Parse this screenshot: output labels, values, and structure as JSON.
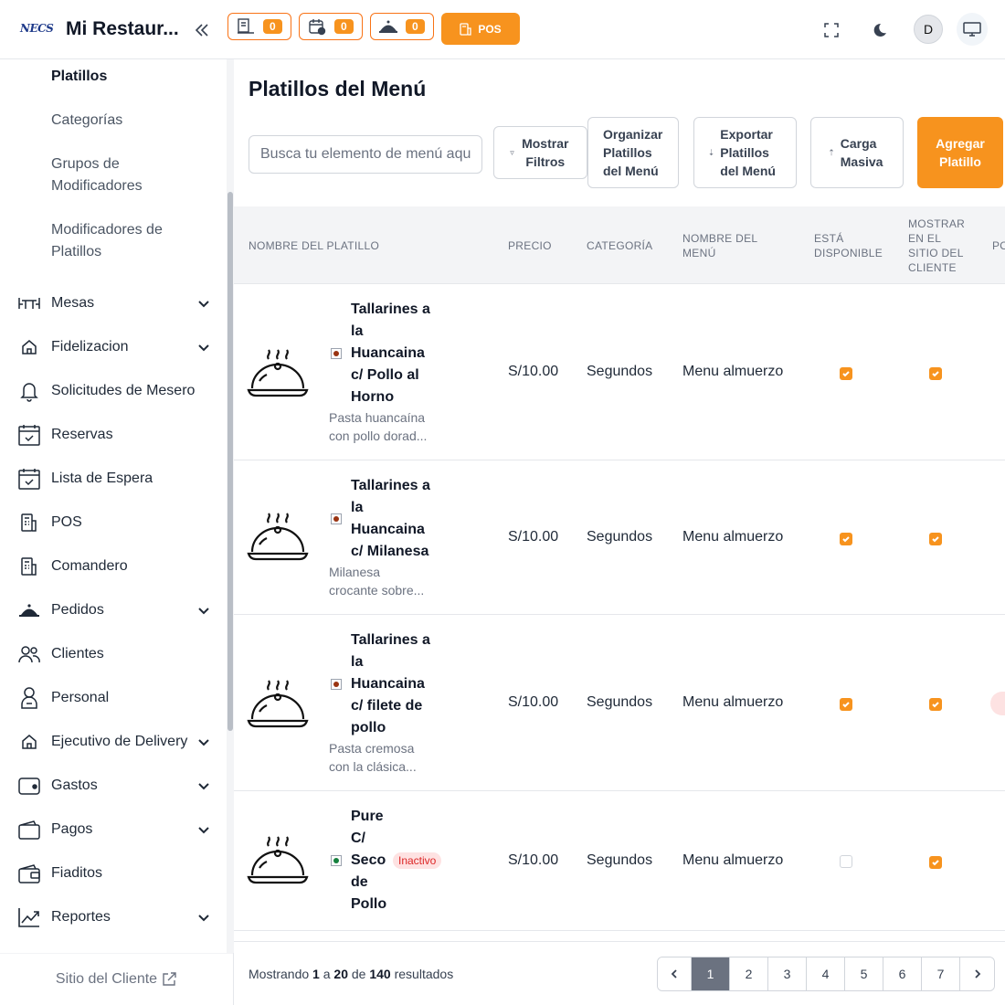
{
  "header": {
    "logo_text": "NECS",
    "restaurant_name": "Mi Restaur...",
    "counters": [
      {
        "name": "orders-counter",
        "value": "0"
      },
      {
        "name": "reservations-counter",
        "value": "0"
      },
      {
        "name": "waiter-counter",
        "value": "0"
      }
    ],
    "pos_label": "POS",
    "avatar_initial": "D"
  },
  "sidebar": {
    "sub_items": [
      "Platillos",
      "Categorías",
      "Grupos de Modificadores",
      "Modificadores de Platillos"
    ],
    "items": [
      {
        "label": "Mesas",
        "icon": "tables-icon",
        "expandable": true
      },
      {
        "label": "Fidelizacion",
        "icon": "home-icon",
        "expandable": true
      },
      {
        "label": "Solicitudes de Mesero",
        "icon": "bell-icon",
        "expandable": false
      },
      {
        "label": "Reservas",
        "icon": "calendar-icon",
        "expandable": false
      },
      {
        "label": "Lista de Espera",
        "icon": "calendar-check-icon",
        "expandable": false
      },
      {
        "label": "POS",
        "icon": "pos-icon",
        "expandable": false
      },
      {
        "label": "Comandero",
        "icon": "pos-icon",
        "expandable": false
      },
      {
        "label": "Pedidos",
        "icon": "cloche-icon",
        "expandable": true
      },
      {
        "label": "Clientes",
        "icon": "users-icon",
        "expandable": false
      },
      {
        "label": "Personal",
        "icon": "person-icon",
        "expandable": false
      },
      {
        "label": "Ejecutivo de Delivery",
        "icon": "home-icon",
        "expandable": true
      },
      {
        "label": "Gastos",
        "icon": "wallet-icon",
        "expandable": true
      },
      {
        "label": "Pagos",
        "icon": "wallet-icon",
        "expandable": true
      },
      {
        "label": "Fiaditos",
        "icon": "wallet-icon",
        "expandable": false
      },
      {
        "label": "Reportes",
        "icon": "chart-icon",
        "expandable": true
      }
    ],
    "footer_link": "Sitio del Cliente"
  },
  "main": {
    "title": "Platillos del Menú",
    "search_placeholder": "Busca tu elemento de menú aquí",
    "buttons": {
      "filters": "Mostrar Filtros",
      "organize": "Organizar Platillos del Menú",
      "export": "Exportar Platillos del Menú",
      "upload": "Carga Masiva",
      "add": "Agregar Platillo"
    }
  },
  "table": {
    "columns": {
      "name": "NOMBRE DEL PLATILLO",
      "price": "PRECIO",
      "category": "CATEGORÍA",
      "menu": "NOMBRE DEL MENÚ",
      "available": "ESTÁ DISPONIBLE",
      "show_site": "MOSTRAR EN EL SITIO DEL CLIENTE",
      "more": "PO"
    },
    "rows": [
      {
        "name_lines": [
          "Tallarines a",
          "la",
          "Huancaina",
          "c/ Pollo al",
          "Horno"
        ],
        "desc_lines": [
          "Pasta huancaína",
          "con pollo dorad..."
        ],
        "price": "S/10.00",
        "category": "Segundos",
        "menu": "Menu almuerzo",
        "available": true,
        "show_site": true,
        "veg_color": "#9a3412",
        "inactive": ""
      },
      {
        "name_lines": [
          "Tallarines a",
          "la",
          "Huancaina",
          "c/ Milanesa"
        ],
        "desc_lines": [
          "Milanesa",
          "crocante sobre..."
        ],
        "price": "S/10.00",
        "category": "Segundos",
        "menu": "Menu almuerzo",
        "available": true,
        "show_site": true,
        "veg_color": "#9a3412",
        "inactive": ""
      },
      {
        "name_lines": [
          "Tallarines a",
          "la",
          "Huancaina",
          "c/ filete de",
          "pollo"
        ],
        "desc_lines": [
          "Pasta cremosa",
          "con la clásica..."
        ],
        "price": "S/10.00",
        "category": "Segundos",
        "menu": "Menu almuerzo",
        "available": true,
        "show_site": true,
        "veg_color": "#9a3412",
        "inactive": ""
      },
      {
        "name_lines": [
          "Pure",
          "C/",
          "Seco",
          "de",
          "Pollo"
        ],
        "desc_lines": [],
        "price": "S/10.00",
        "category": "Segundos",
        "menu": "Menu almuerzo",
        "available": false,
        "show_site": true,
        "veg_color": "#15803d",
        "inactive": "Inactivo"
      }
    ]
  },
  "pagination": {
    "prefix": "Mostrando",
    "from": "1",
    "a": "a",
    "to": "20",
    "de": "de",
    "total": "140",
    "suffix": "resultados",
    "pages": [
      "1",
      "2",
      "3",
      "4",
      "5",
      "6",
      "7"
    ],
    "current": "1"
  },
  "colors": {
    "accent": "#f7931e",
    "muted": "#6b7280"
  }
}
